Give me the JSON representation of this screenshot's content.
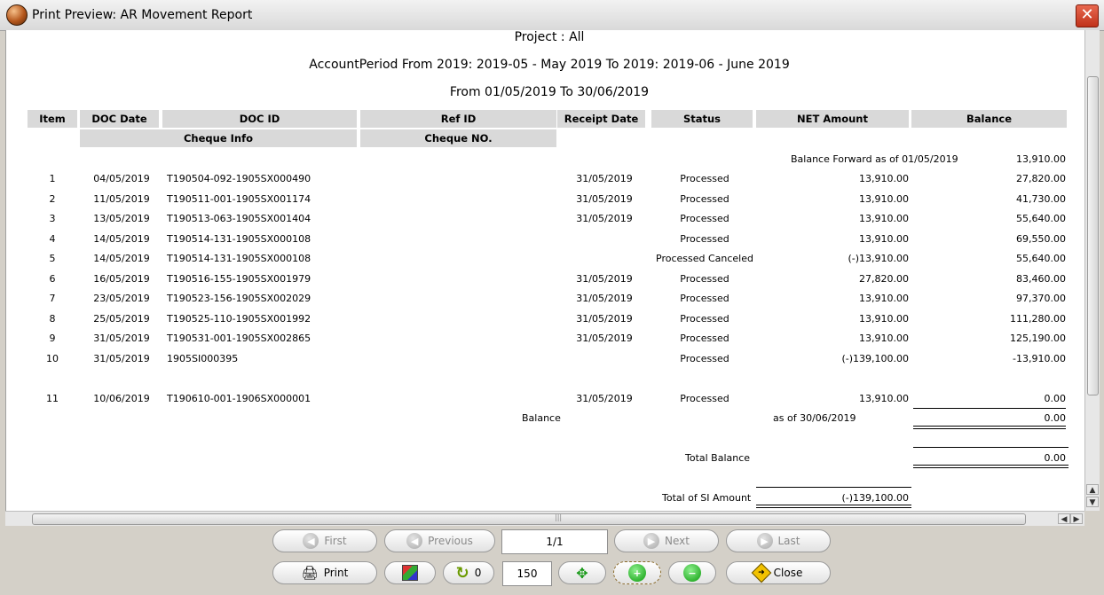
{
  "window": {
    "title": "Print Preview: AR Movement Report",
    "icons": {
      "app": "app-orb-icon",
      "close": "close-icon"
    }
  },
  "report": {
    "project": "Project : All",
    "period": "AccountPeriod From 2019: 2019-05 - May 2019 To 2019: 2019-06 - June 2019",
    "date_range": "From 01/05/2019 To 30/06/2019",
    "columns": {
      "item": "Item",
      "doc_date": "DOC Date",
      "doc_id": "DOC ID",
      "ref_id": "Ref ID",
      "receipt_date": "Receipt Date",
      "status": "Status",
      "net_amount": "NET Amount",
      "balance": "Balance",
      "cheque_info": "Cheque Info",
      "cheque_no": "Cheque NO."
    },
    "balance_forward_label": "Balance Forward as of 01/05/2019",
    "balance_forward_value": "13,910.00",
    "rows": [
      {
        "item": "1",
        "doc_date": "04/05/2019",
        "doc_id": "T190504-092-1905SX000490",
        "receipt_date": "31/05/2019",
        "status": "Processed",
        "net": "13,910.00",
        "balance": "27,820.00"
      },
      {
        "item": "2",
        "doc_date": "11/05/2019",
        "doc_id": "T190511-001-1905SX001174",
        "receipt_date": "31/05/2019",
        "status": "Processed",
        "net": "13,910.00",
        "balance": "41,730.00"
      },
      {
        "item": "3",
        "doc_date": "13/05/2019",
        "doc_id": "T190513-063-1905SX001404",
        "receipt_date": "31/05/2019",
        "status": "Processed",
        "net": "13,910.00",
        "balance": "55,640.00"
      },
      {
        "item": "4",
        "doc_date": "14/05/2019",
        "doc_id": "T190514-131-1905SX000108",
        "receipt_date": "",
        "status": "Processed",
        "net": "13,910.00",
        "balance": "69,550.00"
      },
      {
        "item": "5",
        "doc_date": "14/05/2019",
        "doc_id": "T190514-131-1905SX000108",
        "receipt_date": "",
        "status": "Processed Canceled",
        "net": "(-)13,910.00",
        "balance": "55,640.00"
      },
      {
        "item": "6",
        "doc_date": "16/05/2019",
        "doc_id": "T190516-155-1905SX001979",
        "receipt_date": "31/05/2019",
        "status": "Processed",
        "net": "27,820.00",
        "balance": "83,460.00"
      },
      {
        "item": "7",
        "doc_date": "23/05/2019",
        "doc_id": "T190523-156-1905SX002029",
        "receipt_date": "31/05/2019",
        "status": "Processed",
        "net": "13,910.00",
        "balance": "97,370.00"
      },
      {
        "item": "8",
        "doc_date": "25/05/2019",
        "doc_id": "T190525-110-1905SX001992",
        "receipt_date": "31/05/2019",
        "status": "Processed",
        "net": "13,910.00",
        "balance": "111,280.00"
      },
      {
        "item": "9",
        "doc_date": "31/05/2019",
        "doc_id": "T190531-001-1905SX002865",
        "receipt_date": "31/05/2019",
        "status": "Processed",
        "net": "13,910.00",
        "balance": "125,190.00"
      },
      {
        "item": "10",
        "doc_date": "31/05/2019",
        "doc_id": "1905SI000395",
        "receipt_date": "",
        "status": "Processed",
        "net": "(-)139,100.00",
        "balance": "-13,910.00"
      },
      {
        "item": "11",
        "doc_date": "10/06/2019",
        "doc_id": "T190610-001-1906SX000001",
        "receipt_date": "31/05/2019",
        "status": "Processed",
        "net": "13,910.00",
        "balance": "0.00"
      }
    ],
    "balance_label": "Balance",
    "balance_as_of": "as of 30/06/2019",
    "balance_value": "0.00",
    "total_balance_label": "Total Balance",
    "total_balance_value": "0.00",
    "total_si_label": "Total of SI Amount",
    "total_si_value": "(-)139,100.00"
  },
  "nav": {
    "first": "First",
    "previous": "Previous",
    "page": "1/1",
    "next": "Next",
    "last": "Last",
    "print": "Print",
    "refresh_count": "0",
    "zoom": "150",
    "close": "Close"
  },
  "icons": {
    "first": "first-page-icon",
    "previous": "previous-page-icon",
    "next": "next-page-icon",
    "last": "last-page-icon",
    "print": "printer-icon",
    "export": "export-icon",
    "refresh": "refresh-icon",
    "fit": "fit-page-icon",
    "zoom_in": "zoom-in-icon",
    "zoom_out": "zoom-out-icon",
    "close": "close-arrow-icon"
  }
}
